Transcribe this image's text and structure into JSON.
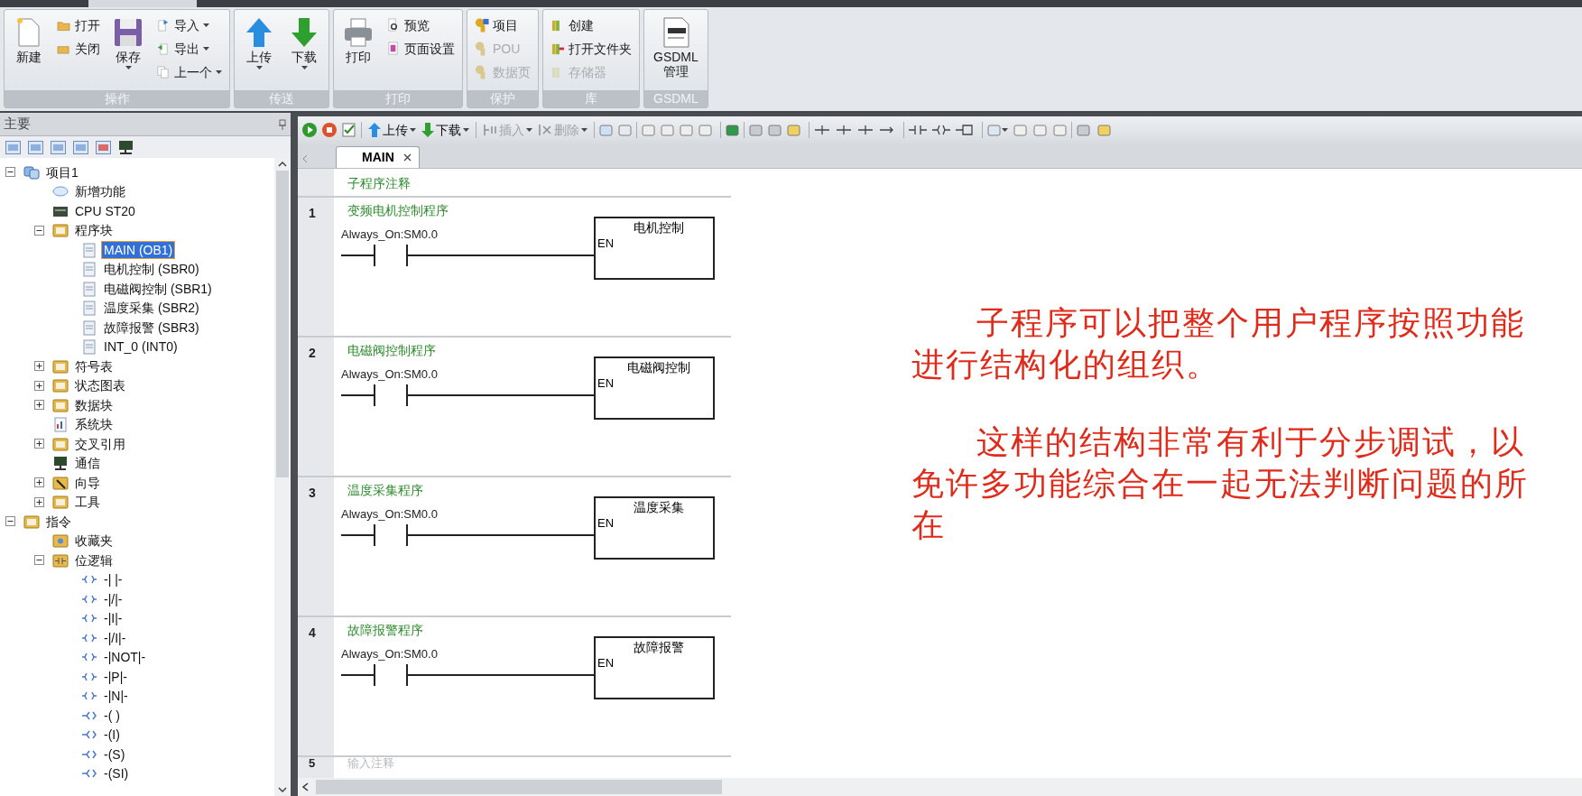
{
  "ribbon": {
    "groups": [
      {
        "label": "操作",
        "buttons": [
          {
            "label": "新建",
            "kind": "large",
            "disabled": false,
            "dropdown": false
          },
          {
            "label": "打开",
            "kind": "small",
            "disabled": false,
            "dropdown": false
          },
          {
            "label": "关闭",
            "kind": "small",
            "disabled": false,
            "dropdown": false
          },
          {
            "label": "保存",
            "kind": "large",
            "disabled": false,
            "dropdown": true
          },
          {
            "label": "导入",
            "kind": "small",
            "disabled": false,
            "dropdown": true
          },
          {
            "label": "导出",
            "kind": "small",
            "disabled": false,
            "dropdown": true
          },
          {
            "label": "上一个",
            "kind": "small",
            "disabled": false,
            "dropdown": true
          }
        ]
      },
      {
        "label": "传送",
        "buttons": [
          {
            "label": "上传",
            "kind": "large",
            "disabled": false,
            "dropdown": true
          },
          {
            "label": "下载",
            "kind": "large",
            "disabled": false,
            "dropdown": true
          }
        ]
      },
      {
        "label": "打印",
        "buttons": [
          {
            "label": "打印",
            "kind": "large",
            "disabled": false,
            "dropdown": false
          },
          {
            "label": "预览",
            "kind": "small",
            "disabled": false,
            "dropdown": false
          },
          {
            "label": "页面设置",
            "kind": "small",
            "disabled": false,
            "dropdown": false
          }
        ]
      },
      {
        "label": "保护",
        "buttons": [
          {
            "label": "项目",
            "kind": "small",
            "disabled": false,
            "dropdown": false
          },
          {
            "label": "POU",
            "kind": "small",
            "disabled": true,
            "dropdown": false
          },
          {
            "label": "数据页",
            "kind": "small",
            "disabled": true,
            "dropdown": false
          }
        ]
      },
      {
        "label": "库",
        "buttons": [
          {
            "label": "创建",
            "kind": "small",
            "disabled": false,
            "dropdown": false
          },
          {
            "label": "打开文件夹",
            "kind": "small",
            "disabled": false,
            "dropdown": false
          },
          {
            "label": "存储器",
            "kind": "small",
            "disabled": true,
            "dropdown": false
          }
        ]
      },
      {
        "label": "GSDML",
        "buttons": [
          {
            "label": "GSDML\n管理",
            "kind": "large",
            "disabled": false,
            "dropdown": false
          }
        ]
      }
    ]
  },
  "panel": {
    "title": "主要",
    "tree": [
      {
        "label": "项目1",
        "kind": "project",
        "expanded": true,
        "selected": false,
        "children": [
          {
            "label": "新增功能",
            "kind": "help",
            "selected": false
          },
          {
            "label": "CPU ST20",
            "kind": "cpu",
            "selected": false
          },
          {
            "label": "程序块",
            "kind": "folder",
            "expanded": true,
            "selected": false,
            "children": [
              {
                "label": "MAIN (OB1)",
                "kind": "page",
                "selected": true
              },
              {
                "label": "电机控制 (SBR0)",
                "kind": "page",
                "selected": false
              },
              {
                "label": "电磁阀控制 (SBR1)",
                "kind": "page",
                "selected": false
              },
              {
                "label": "温度采集 (SBR2)",
                "kind": "page",
                "selected": false
              },
              {
                "label": "故障报警 (SBR3)",
                "kind": "page",
                "selected": false
              },
              {
                "label": "INT_0 (INT0)",
                "kind": "page",
                "selected": false
              }
            ]
          },
          {
            "label": "符号表",
            "kind": "folder",
            "expanded": false,
            "selected": false
          },
          {
            "label": "状态图表",
            "kind": "folder",
            "expanded": false,
            "selected": false
          },
          {
            "label": "数据块",
            "kind": "folder",
            "expanded": false,
            "selected": false
          },
          {
            "label": "系统块",
            "kind": "system",
            "selected": false
          },
          {
            "label": "交叉引用",
            "kind": "folder",
            "expanded": false,
            "selected": false
          },
          {
            "label": "通信",
            "kind": "network",
            "selected": false
          },
          {
            "label": "向导",
            "kind": "wizard",
            "expanded": false,
            "selected": false
          },
          {
            "label": "工具",
            "kind": "folder",
            "expanded": false,
            "selected": false
          }
        ]
      },
      {
        "label": "指令",
        "kind": "folder",
        "expanded": true,
        "selected": false,
        "children": [
          {
            "label": "收藏夹",
            "kind": "favorites",
            "selected": false
          },
          {
            "label": "位逻辑",
            "kind": "bitlogic",
            "expanded": true,
            "selected": false,
            "children": [
              {
                "label": "-| |-",
                "kind": "contact",
                "selected": false
              },
              {
                "label": "-|/|-",
                "kind": "contact",
                "selected": false
              },
              {
                "label": "-|I|-",
                "kind": "contact",
                "selected": false
              },
              {
                "label": "-|/I|-",
                "kind": "contact",
                "selected": false
              },
              {
                "label": "-|NOT|-",
                "kind": "contact",
                "selected": false
              },
              {
                "label": "-|P|-",
                "kind": "contact",
                "selected": false
              },
              {
                "label": "-|N|-",
                "kind": "contact",
                "selected": false
              },
              {
                "label": "-( )",
                "kind": "coil",
                "selected": false
              },
              {
                "label": "-(I)",
                "kind": "coil",
                "selected": false
              },
              {
                "label": "-(S)",
                "kind": "coil",
                "selected": false
              },
              {
                "label": "-(SI)",
                "kind": "coil",
                "selected": false
              }
            ]
          }
        ]
      }
    ]
  },
  "toolbar": {
    "buttons": [
      {
        "label": "上传",
        "disabled": false
      },
      {
        "label": "下载",
        "disabled": false
      },
      {
        "label": "插入",
        "disabled": true
      },
      {
        "label": "删除",
        "disabled": true
      }
    ]
  },
  "editor": {
    "tab": {
      "label": "MAIN",
      "selected": true
    },
    "header_comment": "子程序注释",
    "networks": [
      {
        "number": "1",
        "comment": "变频电机控制程序",
        "contact": "Always_On:SM0.0",
        "box_title": "电机控制",
        "box_input": "EN"
      },
      {
        "number": "2",
        "comment": "电磁阀控制程序",
        "contact": "Always_On:SM0.0",
        "box_title": "电磁阀控制",
        "box_input": "EN"
      },
      {
        "number": "3",
        "comment": "温度采集程序",
        "contact": "Always_On:SM0.0",
        "box_title": "温度采集",
        "box_input": "EN"
      },
      {
        "number": "4",
        "comment": "故障报警程序",
        "contact": "Always_On:SM0.0",
        "box_title": "故障报警",
        "box_input": "EN"
      }
    ],
    "next_network": {
      "number": "5",
      "placeholder": "输入注释"
    }
  },
  "annotation": {
    "paragraphs": [
      "子程序可以把整个用户程序按照功能进行结构化的组织。",
      "这样的结构非常有利于分步调试，以免许多功能综合在一起无法判断问题的所在"
    ]
  }
}
